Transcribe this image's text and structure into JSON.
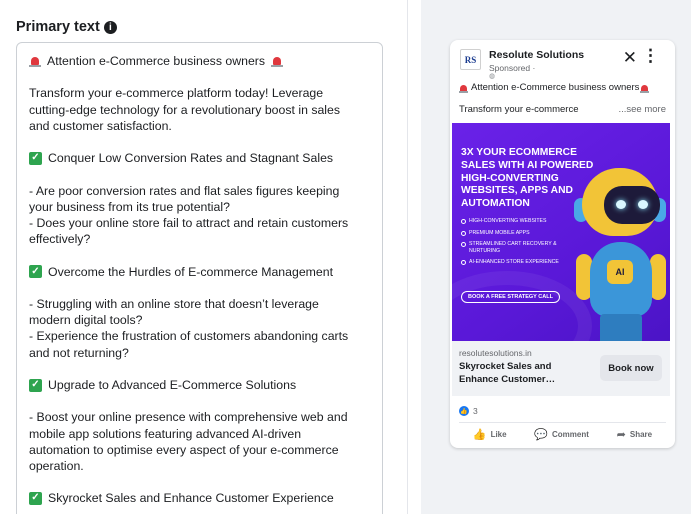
{
  "editor": {
    "label": "Primary text",
    "info_icon": "i",
    "lines": [
      {
        "type": "attn",
        "text": "Attention e-Commerce business owners"
      },
      {
        "type": "blank"
      },
      {
        "type": "text",
        "text": "Transform your e-commerce platform today! Leverage"
      },
      {
        "type": "text",
        "text": "cutting-edge technology for a revolutionary boost in sales"
      },
      {
        "type": "text",
        "text": "and customer satisfaction."
      },
      {
        "type": "blank"
      },
      {
        "type": "check",
        "text": "Conquer Low Conversion Rates and Stagnant Sales"
      },
      {
        "type": "blank"
      },
      {
        "type": "text",
        "text": "- Are poor conversion rates and flat sales figures keeping"
      },
      {
        "type": "text",
        "text": "your business from its true potential?"
      },
      {
        "type": "text",
        "text": "- Does your online store fail to attract and retain customers"
      },
      {
        "type": "text",
        "text": "effectively?"
      },
      {
        "type": "blank"
      },
      {
        "type": "check",
        "text": "Overcome the Hurdles of E-commerce Management"
      },
      {
        "type": "blank"
      },
      {
        "type": "text",
        "text": "- Struggling with an online store that doesn’t leverage"
      },
      {
        "type": "text",
        "text": "modern digital tools?"
      },
      {
        "type": "text",
        "text": "- Experience the frustration of customers abandoning carts"
      },
      {
        "type": "text",
        "text": "and not returning?"
      },
      {
        "type": "blank"
      },
      {
        "type": "check",
        "text": "Upgrade to Advanced E-Commerce Solutions"
      },
      {
        "type": "blank"
      },
      {
        "type": "text",
        "text": "- Boost your online presence with comprehensive web and"
      },
      {
        "type": "text",
        "text": "mobile app solutions featuring advanced AI-driven"
      },
      {
        "type": "text",
        "text": "automation to optimise every aspect of your e-commerce"
      },
      {
        "type": "text",
        "text": "operation."
      },
      {
        "type": "blank"
      },
      {
        "type": "check",
        "text": "Skyrocket Sales and Enhance Customer Experience"
      }
    ]
  },
  "preview": {
    "logo_text": "RS",
    "page_name": "Resolute Solutions",
    "sponsored": "Sponsored ·",
    "globe_icon": "◍",
    "close_icon": "✕",
    "more_icon": "⋮",
    "attention": "Attention e-Commerce business owners",
    "preview_text": "Transform your e-commerce",
    "see_more": "...see more",
    "creative": {
      "headline": "3X YOUR ECOMMERCE SALES WITH AI POWERED HIGH-CONVERTING WEBSITES, APPS AND AUTOMATION",
      "bullets": [
        "HIGH-CONVERTING WEBSITES",
        "PREMIUM MOBILE APPS",
        "STREAMLINED CART RECOVERY & NURTURING",
        "AI-ENHANCED STORE EXPERIENCE"
      ],
      "cta": "BOOK A FREE STRATEGY CALL",
      "robot_badge": "AI",
      "colors": {
        "background": "#5a18d8",
        "robot_yellow": "#f2c437",
        "robot_blue": "#3b96d9"
      }
    },
    "domain": "resolutesolutions.in",
    "ad_title": "Skyrocket Sales and Enhance Customer…",
    "book_button": "Book now",
    "reaction_count": "3",
    "like_icon": "👍",
    "actions": [
      {
        "label": "Like",
        "icon": "like-icon",
        "glyph": "👍"
      },
      {
        "label": "Comment",
        "icon": "comment-icon",
        "glyph": "💬"
      },
      {
        "label": "Share",
        "icon": "share-icon",
        "glyph": "➦"
      }
    ]
  }
}
